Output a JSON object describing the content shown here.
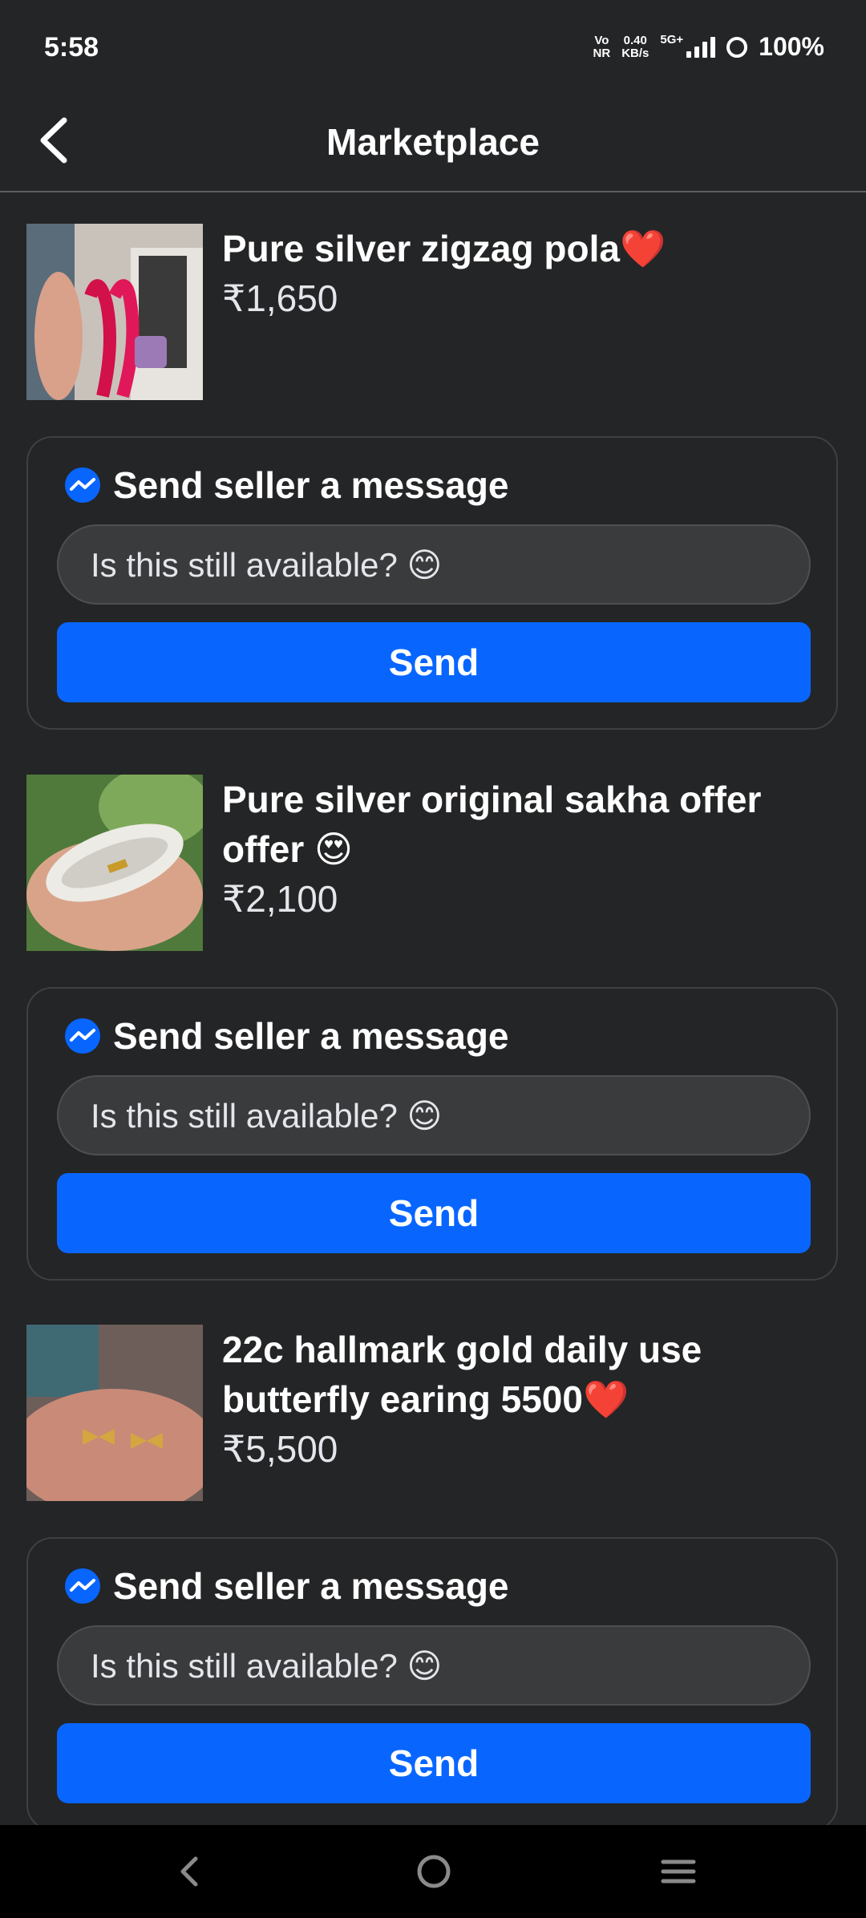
{
  "status": {
    "time": "5:58",
    "net_top": "Vo",
    "net_bottom": "NR",
    "speed_top": "0.40",
    "speed_bottom": "KB/s",
    "gen": "5G+",
    "battery": "100%"
  },
  "header": {
    "title": "Marketplace"
  },
  "message_prompt": "Send seller a message",
  "message_default": "Is this still available? 😊",
  "send_label": "Send",
  "listings": [
    {
      "title": "Pure silver zigzag pola❤️",
      "price": "₹1,650"
    },
    {
      "title": "Pure silver original sakha offer offer 😍",
      "price": "₹2,100"
    },
    {
      "title": "22c hallmark gold daily use butterfly earing 5500❤️",
      "price": "₹5,500"
    }
  ],
  "colors": {
    "background": "#242526",
    "accent": "#0866ff",
    "input": "#3a3b3c"
  },
  "icons": [
    "back-arrow-icon",
    "messenger-icon",
    "nav-back-icon",
    "nav-home-icon",
    "nav-menu-icon"
  ]
}
